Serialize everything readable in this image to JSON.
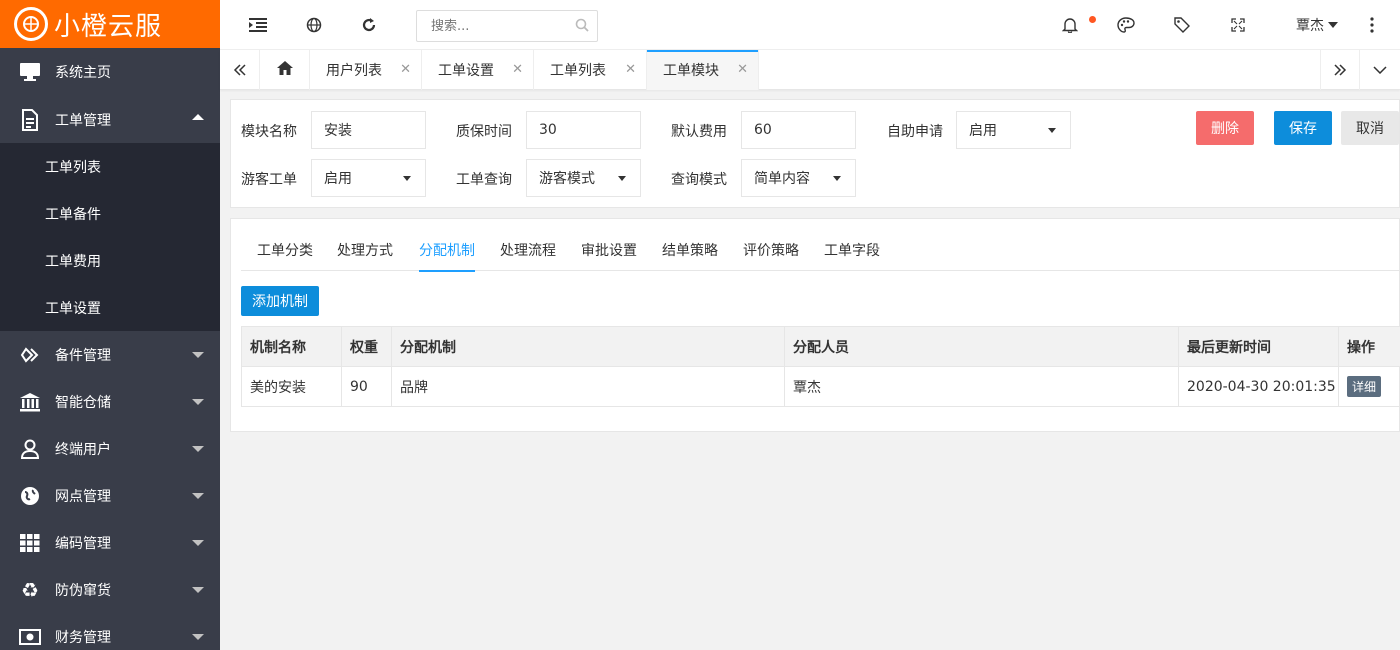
{
  "brand": {
    "logo_text": "小橙云服",
    "accent": "#ff6a00"
  },
  "sidebar": {
    "items": [
      {
        "label": "系统主页",
        "icon": "monitor-icon"
      },
      {
        "label": "工单管理",
        "icon": "document-icon",
        "expanded": true,
        "children": [
          {
            "label": "工单列表"
          },
          {
            "label": "工单备件"
          },
          {
            "label": "工单费用"
          },
          {
            "label": "工单设置"
          }
        ]
      },
      {
        "label": "备件管理",
        "icon": "parts-icon"
      },
      {
        "label": "智能仓储",
        "icon": "bank-icon"
      },
      {
        "label": "终端用户",
        "icon": "user-icon"
      },
      {
        "label": "网点管理",
        "icon": "globe-icon"
      },
      {
        "label": "编码管理",
        "icon": "grid-icon"
      },
      {
        "label": "防伪窜货",
        "icon": "recycle-icon"
      },
      {
        "label": "财务管理",
        "icon": "money-icon"
      }
    ]
  },
  "topbar": {
    "search_placeholder": "搜索...",
    "user_name": "覃杰"
  },
  "tabs": [
    {
      "label": "用户列表"
    },
    {
      "label": "工单设置"
    },
    {
      "label": "工单列表"
    },
    {
      "label": "工单模块",
      "active": true
    }
  ],
  "form": {
    "module_name_label": "模块名称",
    "module_name_value": "安装",
    "warranty_label": "质保时间",
    "warranty_value": "30",
    "default_fee_label": "默认费用",
    "default_fee_value": "60",
    "self_apply_label": "自助申请",
    "self_apply_value": "启用",
    "guest_label": "游客工单",
    "guest_value": "启用",
    "query_label": "工单查询",
    "query_value": "游客模式",
    "query_mode_label": "查询模式",
    "query_mode_value": "简单内容",
    "delete_btn": "删除",
    "save_btn": "保存",
    "cancel_btn": "取消"
  },
  "subtabs": [
    {
      "label": "工单分类"
    },
    {
      "label": "处理方式"
    },
    {
      "label": "分配机制",
      "active": true
    },
    {
      "label": "处理流程"
    },
    {
      "label": "审批设置"
    },
    {
      "label": "结单策略"
    },
    {
      "label": "评价策略"
    },
    {
      "label": "工单字段"
    }
  ],
  "add_btn": "添加机制",
  "table": {
    "headers": [
      "机制名称",
      "权重",
      "分配机制",
      "分配人员",
      "最后更新时间",
      "操作"
    ],
    "rows": [
      [
        "美的安装",
        "90",
        "品牌",
        "覃杰",
        "2020-04-30 20:01:35",
        "详细"
      ]
    ]
  }
}
